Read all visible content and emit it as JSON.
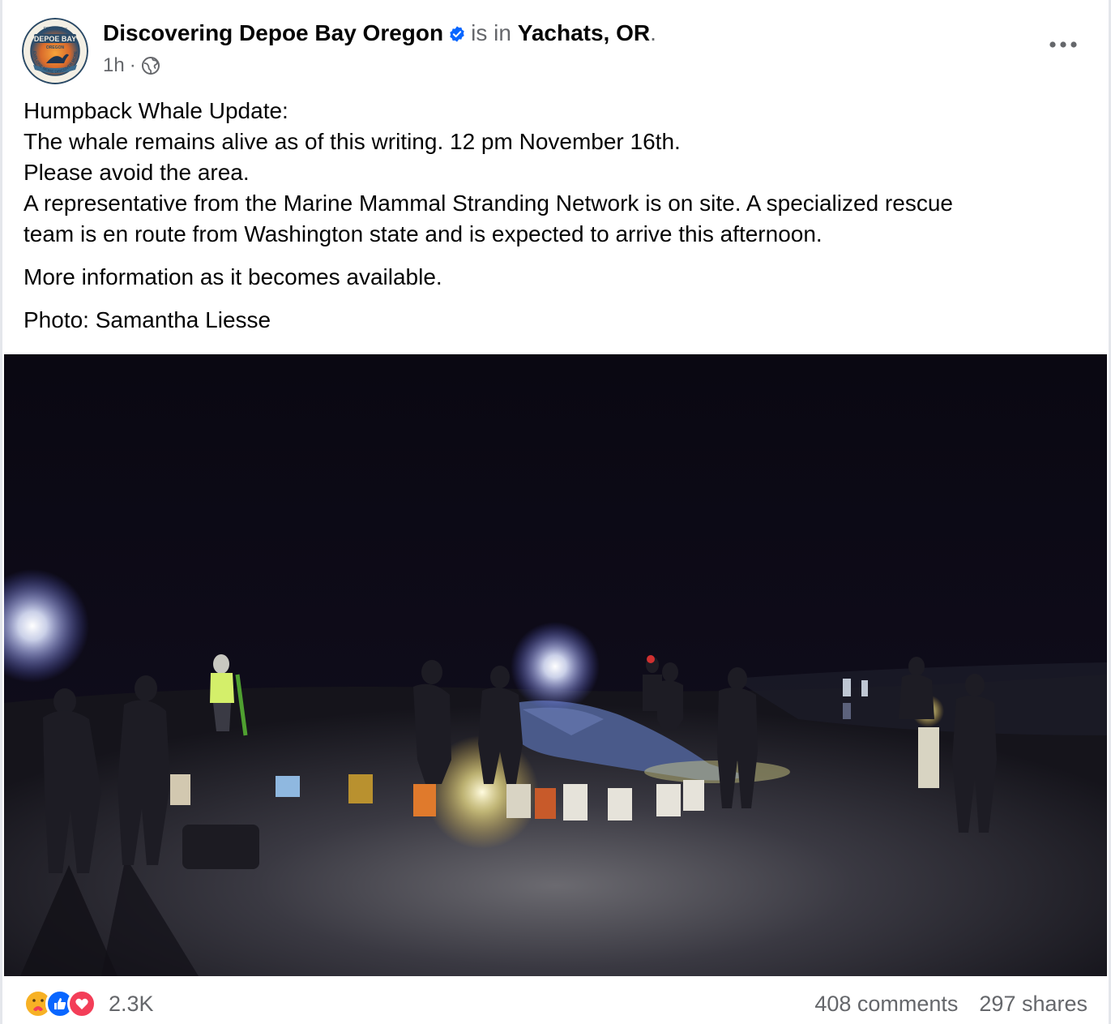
{
  "post": {
    "author": "Discovering Depoe Bay Oregon",
    "location_prefix": "is in",
    "location": "Yachats, OR",
    "location_suffix": ".",
    "time": "1h",
    "dot": "·",
    "avatar_text": {
      "top": "Discovering",
      "main": "DEPOE BAY",
      "sub": "OREGON",
      "ring": "EXPLORE MORE DISCOVER MORE"
    }
  },
  "body": {
    "para1": [
      "Humpback Whale Update:",
      "The whale remains alive as of this writing. 12 pm November 16th.",
      "Please avoid the area.",
      "A representative from the Marine Mammal Stranding Network is on site. A specialized rescue",
      "team is en route from Washington state and is expected to arrive this afternoon."
    ],
    "para2": "More information as it becomes available.",
    "para3": "Photo: Samantha Liesse"
  },
  "footer": {
    "reaction_count": "2.3K",
    "comments": "408 comments",
    "shares": "297 shares"
  },
  "icons": {
    "verified": "verified-badge-icon",
    "globe": "globe-icon",
    "more": "more-options-icon",
    "reactions": [
      "care-reaction-icon",
      "like-reaction-icon",
      "love-reaction-icon"
    ]
  },
  "colors": {
    "verified_blue": "#0866ff",
    "like_blue": "#0866ff",
    "love_red": "#f33e58",
    "care_yellow": "#f7b125",
    "muted_text": "#65676b"
  }
}
